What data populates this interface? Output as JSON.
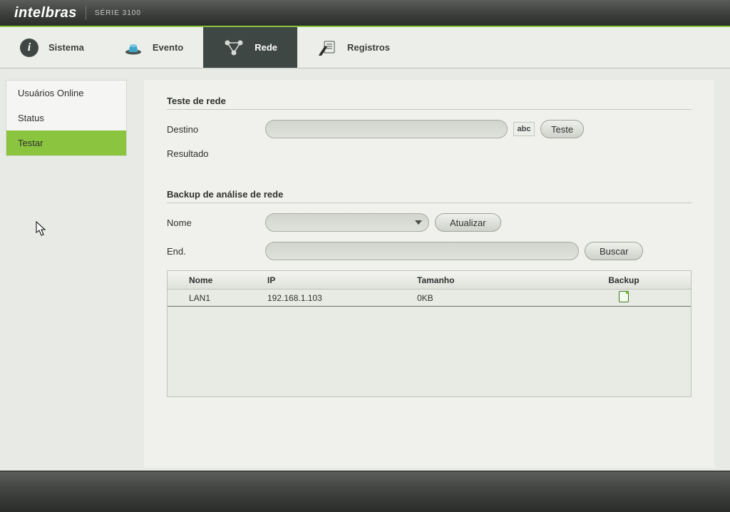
{
  "brand": "intelbras",
  "series": "SÉRIE 3100",
  "nav": {
    "sistema": "Sistema",
    "evento": "Evento",
    "rede": "Rede",
    "registros": "Registros"
  },
  "sidebar": {
    "online": "Usuários Online",
    "status": "Status",
    "testar": "Testar"
  },
  "section1": {
    "title": "Teste de rede",
    "destino_label": "Destino",
    "destino_value": "",
    "abc": "abc",
    "teste_btn": "Teste",
    "resultado_label": "Resultado"
  },
  "section2": {
    "title": "Backup de análise de rede",
    "nome_label": "Nome",
    "nome_value": "",
    "atualizar_btn": "Atualizar",
    "end_label": "End.",
    "end_value": "",
    "buscar_btn": "Buscar"
  },
  "table": {
    "headers": {
      "nome": "Nome",
      "ip": "IP",
      "tamanho": "Tamanho",
      "backup": "Backup"
    },
    "rows": [
      {
        "nome": "LAN1",
        "ip": "192.168.1.103",
        "tamanho": "0KB"
      }
    ]
  }
}
